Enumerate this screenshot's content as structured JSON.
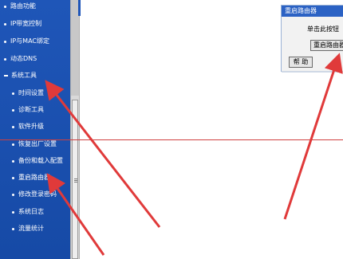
{
  "sidebar": {
    "items": [
      {
        "label": "路由功能",
        "level": "top"
      },
      {
        "label": "IP带宽控制",
        "level": "top"
      },
      {
        "label": "IP与MAC绑定",
        "level": "top"
      },
      {
        "label": "动态DNS",
        "level": "top"
      },
      {
        "label": "系统工具",
        "level": "top-expanded"
      },
      {
        "label": "时间设置",
        "level": "sub"
      },
      {
        "label": "诊断工具",
        "level": "sub"
      },
      {
        "label": "软件升级",
        "level": "sub"
      },
      {
        "label": "恢复出厂设置",
        "level": "sub"
      },
      {
        "label": "备份和载入配置",
        "level": "sub"
      },
      {
        "label": "重启路由器",
        "level": "sub"
      },
      {
        "label": "修改登录密码",
        "level": "sub"
      },
      {
        "label": "系统日志",
        "level": "sub"
      },
      {
        "label": "流量统计",
        "level": "sub"
      }
    ]
  },
  "dialog": {
    "title": "重启路由器",
    "text": "单击此按钮",
    "reboot_button": "重启路由器",
    "help_button": "帮 助"
  },
  "colors": {
    "sidebar": "#1a4fb0",
    "arrow": "#e03a3a",
    "dialog_title": "#2b62c4"
  }
}
